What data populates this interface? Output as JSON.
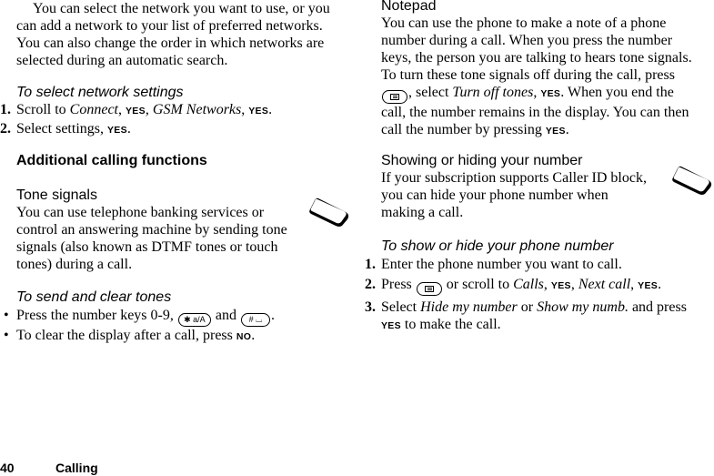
{
  "left": {
    "intro": "You can select the network you want to use, or you can add a network to your list of preferred networks. You can also change the order in which networks are selected during an automatic search.",
    "select_network": {
      "heading": "To select network settings",
      "steps": [
        {
          "num": "1.",
          "parts": [
            "Scroll to ",
            "Connect",
            ", ",
            "YES",
            ", ",
            "GSM Networks",
            ", ",
            "YES",
            "."
          ]
        },
        {
          "num": "2.",
          "parts": [
            "Select settings, ",
            "YES",
            "."
          ]
        }
      ]
    },
    "section_title": "Additional calling functions",
    "tone_signals": {
      "heading": "Tone signals",
      "body": "You can use telephone banking services or control an answering machine by sending tone signals (also known as DTMF tones or touch tones) during a call."
    },
    "send_clear": {
      "heading": "To send and clear tones",
      "bullets": [
        {
          "bullet": "•",
          "text_before": "Press the number keys 0-9, ",
          "key1": "✱ a/A",
          "middle": " and ",
          "key2": "# ⌴",
          "after": "."
        },
        {
          "bullet": "•",
          "text_before": "To clear the display after a call, press ",
          "key_label": "NO",
          "after": "."
        }
      ]
    }
  },
  "right": {
    "notepad": {
      "heading": "Notepad",
      "lines": [
        "You can use the phone to make a note of a phone",
        "number during a call. When you press the number",
        "keys, the person you are talking to hears tone signals.",
        "To turn these tone signals off during the call, press"
      ],
      "line5_after_key": ", select ",
      "line5_italic": "Turn off tones",
      "line5_sep": ", ",
      "line5_yes": "YES",
      "line5_end": ". When you end the",
      "line6": "call, the number remains in the display. You can then",
      "line7_before": "call the number by pressing ",
      "line7_yes": "YES",
      "line7_end": "."
    },
    "showing_hiding": {
      "heading": "Showing or hiding your number",
      "lines": [
        "If your subscription supports Caller ID block,",
        "you can hide your phone number when",
        "making a call."
      ]
    },
    "show_hide_steps": {
      "heading": "To show or hide your phone number",
      "step1": {
        "num": "1.",
        "text": "Enter the phone number you want to call."
      },
      "step2": {
        "num": "2.",
        "before": "Press ",
        "after_key": " or scroll to ",
        "calls": "Calls",
        "sep1": ", ",
        "yes1": "YES",
        "sep2": ", ",
        "next_call": "Next call",
        "sep3": ", ",
        "yes2": "YES",
        "end": "."
      },
      "step3": {
        "num": "3.",
        "before": "Select ",
        "hide": "Hide my number",
        "or": " or ",
        "show": "Show my numb.",
        "after": " and press",
        "yes": "YES",
        "end": " to make the call."
      }
    }
  },
  "footer": {
    "page_number": "40",
    "chapter": "Calling"
  },
  "icons": {
    "phone_icon": "phone-display-icon",
    "menu_key": "menu-key-icon"
  }
}
